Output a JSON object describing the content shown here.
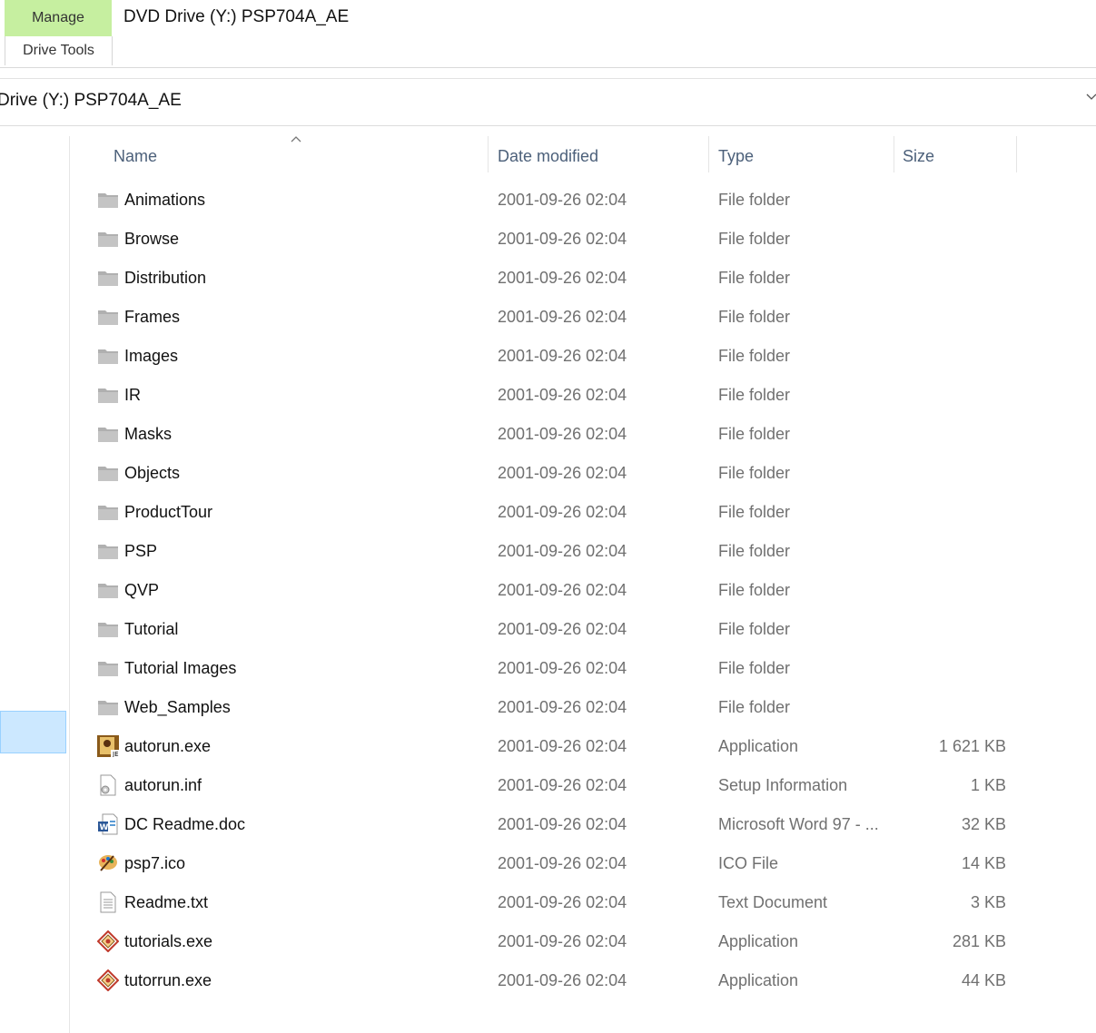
{
  "ribbon": {
    "manage_label": "Manage",
    "drive_tools_label": "Drive Tools",
    "window_title": "DVD Drive (Y:) PSP704A_AE"
  },
  "address_bar": {
    "path": "Drive (Y:) PSP704A_AE",
    "dropdown_icon": "chevron-down-icon"
  },
  "columns": {
    "name": "Name",
    "date": "Date modified",
    "type": "Type",
    "size": "Size",
    "sort_icon": "sort-ascending-icon"
  },
  "files": [
    {
      "name": "Animations",
      "date": "2001-09-26 02:04",
      "type": "File folder",
      "size": "",
      "icon": "folder-icon"
    },
    {
      "name": "Browse",
      "date": "2001-09-26 02:04",
      "type": "File folder",
      "size": "",
      "icon": "folder-icon"
    },
    {
      "name": "Distribution",
      "date": "2001-09-26 02:04",
      "type": "File folder",
      "size": "",
      "icon": "folder-icon"
    },
    {
      "name": "Frames",
      "date": "2001-09-26 02:04",
      "type": "File folder",
      "size": "",
      "icon": "folder-icon"
    },
    {
      "name": "Images",
      "date": "2001-09-26 02:04",
      "type": "File folder",
      "size": "",
      "icon": "folder-icon"
    },
    {
      "name": "IR",
      "date": "2001-09-26 02:04",
      "type": "File folder",
      "size": "",
      "icon": "folder-icon"
    },
    {
      "name": "Masks",
      "date": "2001-09-26 02:04",
      "type": "File folder",
      "size": "",
      "icon": "folder-icon"
    },
    {
      "name": "Objects",
      "date": "2001-09-26 02:04",
      "type": "File folder",
      "size": "",
      "icon": "folder-icon"
    },
    {
      "name": "ProductTour",
      "date": "2001-09-26 02:04",
      "type": "File folder",
      "size": "",
      "icon": "folder-icon"
    },
    {
      "name": "PSP",
      "date": "2001-09-26 02:04",
      "type": "File folder",
      "size": "",
      "icon": "folder-icon"
    },
    {
      "name": "QVP",
      "date": "2001-09-26 02:04",
      "type": "File folder",
      "size": "",
      "icon": "folder-icon"
    },
    {
      "name": "Tutorial",
      "date": "2001-09-26 02:04",
      "type": "File folder",
      "size": "",
      "icon": "folder-icon"
    },
    {
      "name": "Tutorial Images",
      "date": "2001-09-26 02:04",
      "type": "File folder",
      "size": "",
      "icon": "folder-icon"
    },
    {
      "name": "Web_Samples",
      "date": "2001-09-26 02:04",
      "type": "File folder",
      "size": "",
      "icon": "folder-icon"
    },
    {
      "name": "autorun.exe",
      "date": "2001-09-26 02:04",
      "type": "Application",
      "size": "1 621 KB",
      "icon": "psp-app-icon"
    },
    {
      "name": "autorun.inf",
      "date": "2001-09-26 02:04",
      "type": "Setup Information",
      "size": "1 KB",
      "icon": "setup-file-icon"
    },
    {
      "name": "DC Readme.doc",
      "date": "2001-09-26 02:04",
      "type": "Microsoft Word 97 - ...",
      "size": "32 KB",
      "icon": "word-document-icon"
    },
    {
      "name": "psp7.ico",
      "date": "2001-09-26 02:04",
      "type": "ICO File",
      "size": "14 KB",
      "icon": "palette-icon"
    },
    {
      "name": "Readme.txt",
      "date": "2001-09-26 02:04",
      "type": "Text Document",
      "size": "3 KB",
      "icon": "text-document-icon"
    },
    {
      "name": "tutorials.exe",
      "date": "2001-09-26 02:04",
      "type": "Application",
      "size": "281 KB",
      "icon": "tutorial-app-icon"
    },
    {
      "name": "tutorrun.exe",
      "date": "2001-09-26 02:04",
      "type": "Application",
      "size": "44 KB",
      "icon": "tutorial-app-icon"
    }
  ],
  "colors": {
    "manage_tab_bg": "#c6efa0",
    "selection_bg": "#cce8ff",
    "selection_border": "#99d1ff",
    "header_text": "#4c607a",
    "secondary_text": "#707070"
  }
}
